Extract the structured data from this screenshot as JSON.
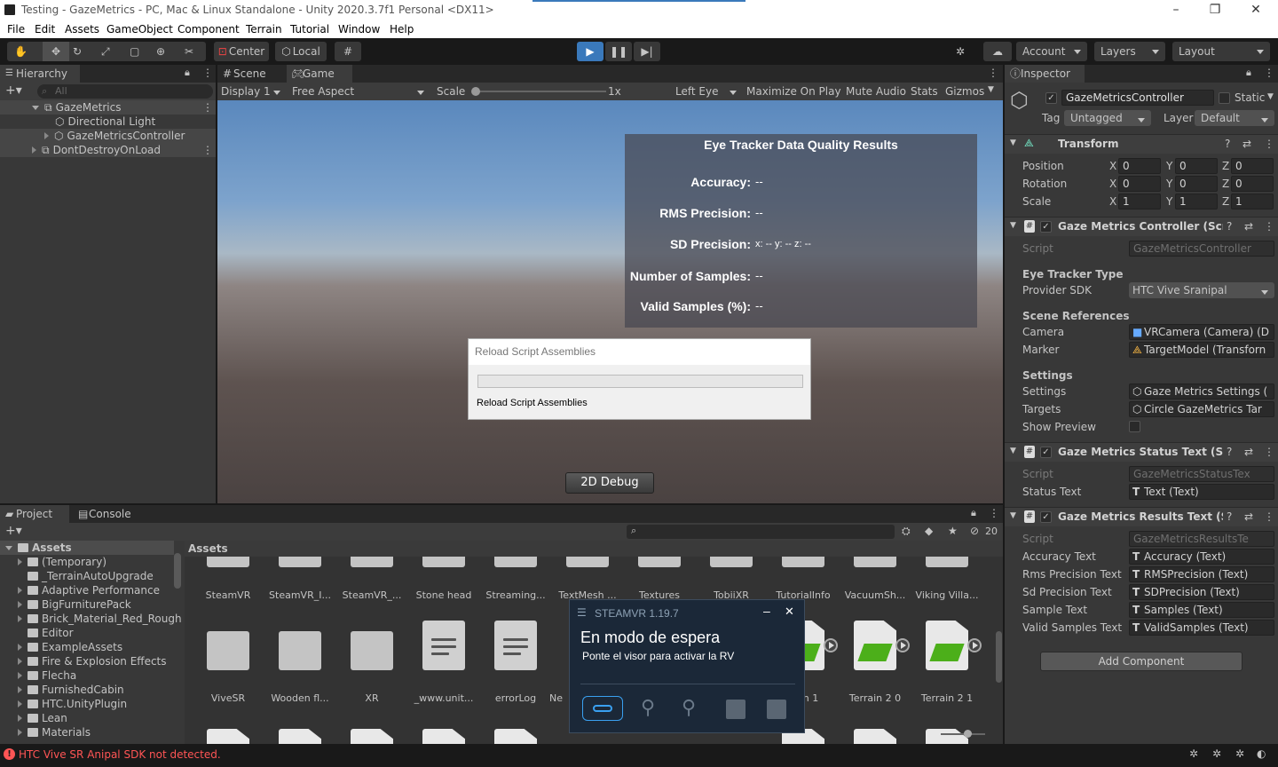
{
  "window": {
    "title": "Testing - GazeMetrics - PC, Mac & Linux Standalone - Unity 2020.3.7f1 Personal <DX11>"
  },
  "menu": [
    "File",
    "Edit",
    "Assets",
    "GameObject",
    "Component",
    "Terrain",
    "Tutorial",
    "Window",
    "Help"
  ],
  "toolbar": {
    "center_label": "Center",
    "local_label": "Local",
    "account": "Account",
    "layers": "Layers",
    "layout": "Layout"
  },
  "hierarchy": {
    "tab": "Hierarchy",
    "search_placeholder": "All",
    "items": [
      {
        "label": "GazeMetrics"
      },
      {
        "label": "Directional Light"
      },
      {
        "label": "GazeMetricsController"
      },
      {
        "label": "DontDestroyOnLoad"
      }
    ]
  },
  "game": {
    "tabs": [
      "Scene",
      "Game"
    ],
    "display": "Display 1",
    "aspect": "Free Aspect",
    "scale_label": "Scale",
    "scale_value": "1x",
    "eye": "Left Eye",
    "maximize": "Maximize On Play",
    "mute": "Mute Audio",
    "stats": "Stats",
    "gizmos": "Gizmos",
    "results": {
      "title": "Eye Tracker Data Quality Results",
      "lines": [
        {
          "label": "Accuracy:",
          "value": "--"
        },
        {
          "label": "RMS Precision:",
          "value": "--"
        },
        {
          "label": "SD Precision:",
          "value": "x: -- y: -- z: --"
        },
        {
          "label": "Number of Samples:",
          "value": "--"
        },
        {
          "label": "Valid Samples (%):",
          "value": "--"
        }
      ]
    },
    "debug_button": "2D Debug"
  },
  "reload_dialog": {
    "title": "Reload Script Assemblies",
    "text": "Reload Script Assemblies",
    "progress": 0
  },
  "inspector": {
    "tab": "Inspector",
    "object_name": "GazeMetricsController",
    "static_label": "Static",
    "tag_label": "Tag",
    "tag_value": "Untagged",
    "layer_label": "Layer",
    "layer_value": "Default",
    "transform": {
      "title": "Transform",
      "rows": [
        {
          "label": "Position",
          "x": "0",
          "y": "0",
          "z": "0"
        },
        {
          "label": "Rotation",
          "x": "0",
          "y": "0",
          "z": "0"
        },
        {
          "label": "Scale",
          "x": "1",
          "y": "1",
          "z": "1"
        }
      ]
    },
    "controller": {
      "title": "Gaze Metrics Controller (Script",
      "script_label": "Script",
      "script_value": "GazeMetricsController",
      "eye_tracker_type": "Eye Tracker Type",
      "provider_label": "Provider SDK",
      "provider_value": "HTC Vive Sranipal",
      "scene_refs": "Scene References",
      "camera_label": "Camera",
      "camera_value": "VRCamera (Camera) (D",
      "marker_label": "Marker",
      "marker_value": "TargetModel (Transforn",
      "settings_hdr": "Settings",
      "settings_label": "Settings",
      "settings_value": "Gaze Metrics Settings (",
      "targets_label": "Targets",
      "targets_value": "Circle GazeMetrics Tar",
      "preview_label": "Show Preview"
    },
    "status_text": {
      "title": "Gaze Metrics Status Text (Scrip",
      "script_label": "Script",
      "script_value": "GazeMetricsStatusTex",
      "status_label": "Status Text",
      "status_value": "Text (Text)"
    },
    "results_text": {
      "title": "Gaze Metrics Results Text (Scr",
      "script_label": "Script",
      "script_value": "GazeMetricsResultsTe",
      "rows": [
        {
          "label": "Accuracy Text",
          "value": "Accuracy (Text)"
        },
        {
          "label": "Rms Precision Text",
          "value": "RMSPrecision (Text)"
        },
        {
          "label": "Sd Precision Text",
          "value": "SDPrecision (Text)"
        },
        {
          "label": "Sample Text",
          "value": "Samples (Text)"
        },
        {
          "label": "Valid Samples Text",
          "value": "ValidSamples (Text)"
        }
      ]
    },
    "add_component": "Add Component"
  },
  "project": {
    "tabs": [
      "Project",
      "Console"
    ],
    "hidden_count": "20",
    "tree_root": "Assets",
    "tree": [
      "(Temporary)",
      "_TerrainAutoUpgrade",
      "Adaptive Performance",
      "BigFurniturePack",
      "Brick_Material_Red_Rough",
      "Editor",
      "ExampleAssets",
      "Fire & Explosion Effects",
      "Flecha",
      "FurnishedCabin",
      "HTC.UnityPlugin",
      "Lean",
      "Materials"
    ],
    "breadcrumb": "Assets",
    "row1": [
      "SteamVR",
      "SteamVR_I...",
      "SteamVR_...",
      "Stone head",
      "Streaming...",
      "TextMesh ...",
      "Textures",
      "TobiiXR",
      "TutorialInfo",
      "VacuumSh...",
      "Viking Villa..."
    ],
    "row2": [
      {
        "label": "ViveSR",
        "kind": "folder"
      },
      {
        "label": "Wooden fl...",
        "kind": "folder"
      },
      {
        "label": "XR",
        "kind": "folder"
      },
      {
        "label": "_www.unit...",
        "kind": "doc"
      },
      {
        "label": "errorLog",
        "kind": "doc"
      },
      {
        "label": "Ne",
        "kind": "hidden"
      },
      {
        "label": "",
        "kind": "hidden"
      },
      {
        "label": "ain 1",
        "kind": "terrain"
      },
      {
        "label": "Terrain 2 0",
        "kind": "terrain"
      },
      {
        "label": "Terrain 2 1",
        "kind": "terrain"
      }
    ]
  },
  "steamvr": {
    "title": "STEAMVR 1.19.7",
    "heading": "En modo de espera",
    "subtext": "Ponte el visor para activar la RV"
  },
  "statusbar": {
    "message": "HTC Vive SR Anipal SDK not detected."
  },
  "colors": {
    "accent": "#3a79bb",
    "error": "#ff5555",
    "green": "#4caf1a"
  }
}
